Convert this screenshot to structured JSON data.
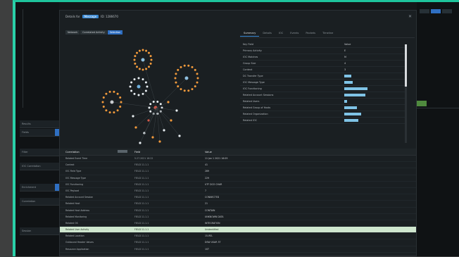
{
  "modal": {
    "title_prefix": "Details for",
    "title_pill": "Message",
    "title_suffix": "ID: 1286670",
    "close_icon": "close-icon"
  },
  "crumbs": [
    "Network",
    "Correlated Activity",
    "Selection"
  ],
  "tabs": [
    "Summary",
    "Details",
    "IOC",
    "Events",
    "Packets",
    "Timeline"
  ],
  "properties": {
    "header": {
      "key": "Key Field",
      "value": "Value"
    },
    "rows": [
      {
        "key": "Primary Activity",
        "value": "E"
      },
      {
        "key": "IOC Matches",
        "value": "M"
      },
      {
        "key": "Group Size",
        "value": "4"
      },
      {
        "key": "Context",
        "value": "3"
      },
      {
        "key": "DC Transfer Type",
        "value": "",
        "chip": 0.16
      },
      {
        "key": "IOC Message Type",
        "value": "",
        "chip": 0.2
      },
      {
        "key": "IOC Functioning",
        "value": "",
        "chip": 0.55
      },
      {
        "key": "Related Account Sessions",
        "value": "",
        "chip": 0.5
      },
      {
        "key": "Related Users",
        "value": "",
        "chip": 0.06
      },
      {
        "key": "Related Group of Hosts",
        "value": "",
        "chip": 0.3
      },
      {
        "key": "Related Organization",
        "value": "",
        "chip": 0.4
      },
      {
        "key": "Related IOC",
        "value": "",
        "chip": 0.33
      }
    ]
  },
  "events": {
    "headers": {
      "col1": "Correlation",
      "col2": "Field",
      "col3": "Value"
    },
    "rows": [
      {
        "c1": "Related Event Time",
        "c2": "5.27.2021 16:22",
        "c3": "11 Jan 1 2021 16:09"
      },
      {
        "c1": "Context",
        "c2": "FIELD 11.1.1",
        "c3": "41"
      },
      {
        "c1": "IOC Field Type",
        "c2": "FIELD 11.1.1",
        "c3": "289"
      },
      {
        "c1": "IOC Message Type",
        "c2": "FIELD 11.1.1",
        "c3": "229"
      },
      {
        "c1": "IOC Functioning",
        "c2": "FIELD 11.1.1",
        "c3": "UTF DCO CHAR"
      },
      {
        "c1": "IOC Payload",
        "c2": "FIELD 11.1.1",
        "c3": "7"
      },
      {
        "c1": "Related Account Session",
        "c2": "FIELD 11.1.1",
        "c3": "CONNECTED"
      },
      {
        "c1": "Related Host",
        "c2": "FIELD 11.1.1",
        "c3": "21"
      },
      {
        "c1": "Related Host Address",
        "c2": "FIELD 11.1.1",
        "c3": "CONTAIN"
      },
      {
        "c1": "Related Monitoring",
        "c2": "FIELD 11.1.1",
        "c3": "UNKNOWN DATA"
      },
      {
        "c1": "Related OS",
        "c2": "FIELD 11.1.1",
        "c3": "INTEGRATION"
      },
      {
        "c1": "Related User Activity",
        "c2": "FIELD 11.1.1",
        "c3": "Unidentified",
        "selected": true
      },
      {
        "c1": "Related Location",
        "c2": "FIELD 11.1.1",
        "c3": "15-REL"
      },
      {
        "c1": "Outbound Header Values",
        "c2": "FIELD 11.1.1",
        "c3": "DSW USAR 3T"
      },
      {
        "c1": "Resource Application",
        "c2": "FIELD 11.1.1",
        "c3": "1ST"
      }
    ]
  },
  "background": {
    "left_items": [
      "Results",
      "Fields",
      "Filter",
      "IOC Correlation",
      "Enrichment",
      "Correlation",
      "Session"
    ],
    "right_tabs": [
      "Tab",
      "Active",
      "Tab"
    ]
  },
  "colors": {
    "accent": "#2f6fc2",
    "frame": "#1ec49c",
    "selected_row": "#cfe7cf"
  }
}
